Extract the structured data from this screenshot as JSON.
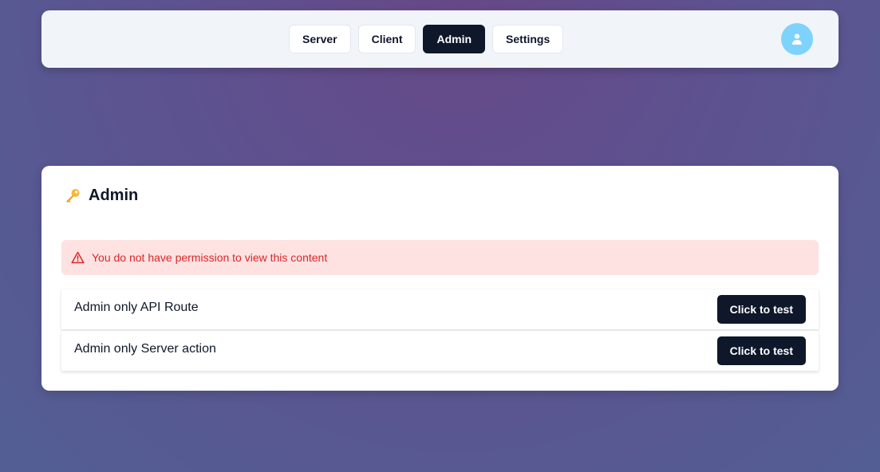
{
  "nav": {
    "tabs": [
      {
        "label": "Server"
      },
      {
        "label": "Client"
      },
      {
        "label": "Admin",
        "active": true
      },
      {
        "label": "Settings"
      }
    ],
    "avatar_icon": "user-icon"
  },
  "card": {
    "icon": "key-icon",
    "title": "Admin",
    "alert": {
      "icon": "warning-icon",
      "message": "You do not have permission to view this content"
    },
    "rows": [
      {
        "label": "Admin only API Route",
        "button_label": "Click to test"
      },
      {
        "label": "Admin only Server action",
        "button_label": "Click to test"
      }
    ]
  },
  "colors": {
    "nav_active": "#0f172a",
    "avatar": "#7dd3fc",
    "alert_bg": "#fee2e2",
    "alert_text": "#dc2626",
    "button_bg": "#0f172a"
  }
}
